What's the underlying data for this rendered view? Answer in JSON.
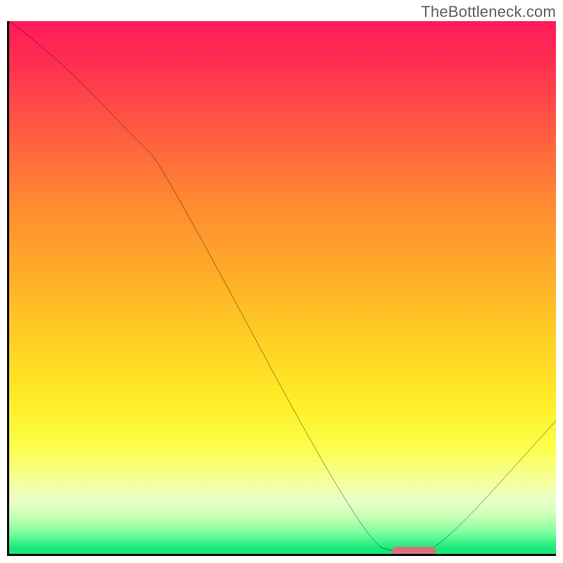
{
  "watermark": "TheBottleneck.com",
  "chart_data": {
    "type": "line",
    "title": "",
    "xlabel": "",
    "ylabel": "",
    "xlim": [
      0,
      100
    ],
    "ylim": [
      0,
      100
    ],
    "grid": false,
    "legend": false,
    "series": [
      {
        "name": "bottleneck-curve",
        "x": [
          0,
          8,
          24,
          28,
          65,
          72,
          78,
          100
        ],
        "y": [
          100,
          94,
          77,
          73,
          2,
          0,
          0,
          25
        ]
      }
    ],
    "marker": {
      "name": "optimal-region",
      "x_start": 70,
      "x_end": 78,
      "y": 0,
      "color": "#d9717c"
    },
    "background_gradient_stops": [
      {
        "pos": 0.0,
        "color": "#ff1a5b"
      },
      {
        "pos": 0.15,
        "color": "#ff4848"
      },
      {
        "pos": 0.35,
        "color": "#ff8c30"
      },
      {
        "pos": 0.6,
        "color": "#ffd024"
      },
      {
        "pos": 0.8,
        "color": "#fbff4a"
      },
      {
        "pos": 0.93,
        "color": "#c8ffb3"
      },
      {
        "pos": 1.0,
        "color": "#18e87a"
      }
    ]
  }
}
